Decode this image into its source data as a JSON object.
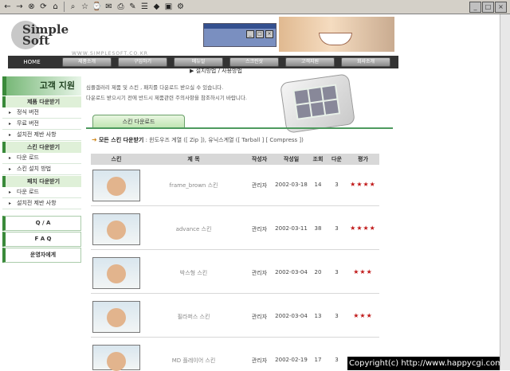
{
  "header": {
    "logo_line1": "Simple",
    "logo_line2": "Soft",
    "logo_url": "WWW.SIMPLESOFT.CO.KR"
  },
  "nav": {
    "home": "HOME",
    "items": [
      "제품소개",
      "구입하기",
      "메뉴얼",
      "스크린샷",
      "고객지원",
      "회사소개"
    ]
  },
  "subnav": "▶ 설치방법 / 사용방법",
  "sidebar": {
    "title": "고객 지원",
    "sections": [
      {
        "title": "제품 다운받기",
        "links": [
          "정식 버전",
          "무료 버전",
          "설치전 제반 사항"
        ]
      },
      {
        "title": "스킨 다운받기",
        "links": [
          "다운 로드",
          "스킨 설치 방법"
        ]
      },
      {
        "title": "패치 다운받기",
        "links": [
          "다운 로드",
          "설치전 제반 사항"
        ]
      }
    ],
    "boxes": [
      "Q / A",
      "F A Q",
      "운영자에게"
    ]
  },
  "notice": {
    "line1": "심플갤러리 제품 및 스킨 , 패치를 다운로드 받으실 수 있습니다.",
    "line2": "다운로드 받으시기 전에 반드시 제품관련 주의사항을 참조하시기 바랍니다."
  },
  "tab": "스킨 다운로드",
  "download": {
    "bold": "모든 스킨 다운받기",
    "text": " : 윈도우즈 계열 ([ Zip ]), 유닉스계열 ([ Tarball ] [ Compress ])"
  },
  "table": {
    "headers": [
      "스킨",
      "제   목",
      "작성자",
      "작성일",
      "조회",
      "다운",
      "평가"
    ],
    "rows": [
      {
        "title": "frame_brown 스킨",
        "author": "관리자",
        "date": "2002-03-18",
        "views": "14",
        "downloads": "3",
        "rating": "★★★★"
      },
      {
        "title": "advance 스킨",
        "author": "관리자",
        "date": "2002-03-11",
        "views": "38",
        "downloads": "3",
        "rating": "★★★★"
      },
      {
        "title": "박스형 스킨",
        "author": "관리자",
        "date": "2002-03-04",
        "views": "20",
        "downloads": "3",
        "rating": "★★★"
      },
      {
        "title": "필라퍼스 스킨",
        "author": "관리자",
        "date": "2002-03-04",
        "views": "13",
        "downloads": "3",
        "rating": "★★★"
      },
      {
        "title": "MD 플레이어 스킨",
        "author": "관리자",
        "date": "2002-02-19",
        "views": "17",
        "downloads": "3",
        "rating": "★★★"
      }
    ]
  },
  "copyright": "Copyright(c) http://www.happycgi.com",
  "colors": {
    "accent": "#4e9a5e",
    "rating": "#c01818",
    "toolbar": "#d4d0c8"
  }
}
